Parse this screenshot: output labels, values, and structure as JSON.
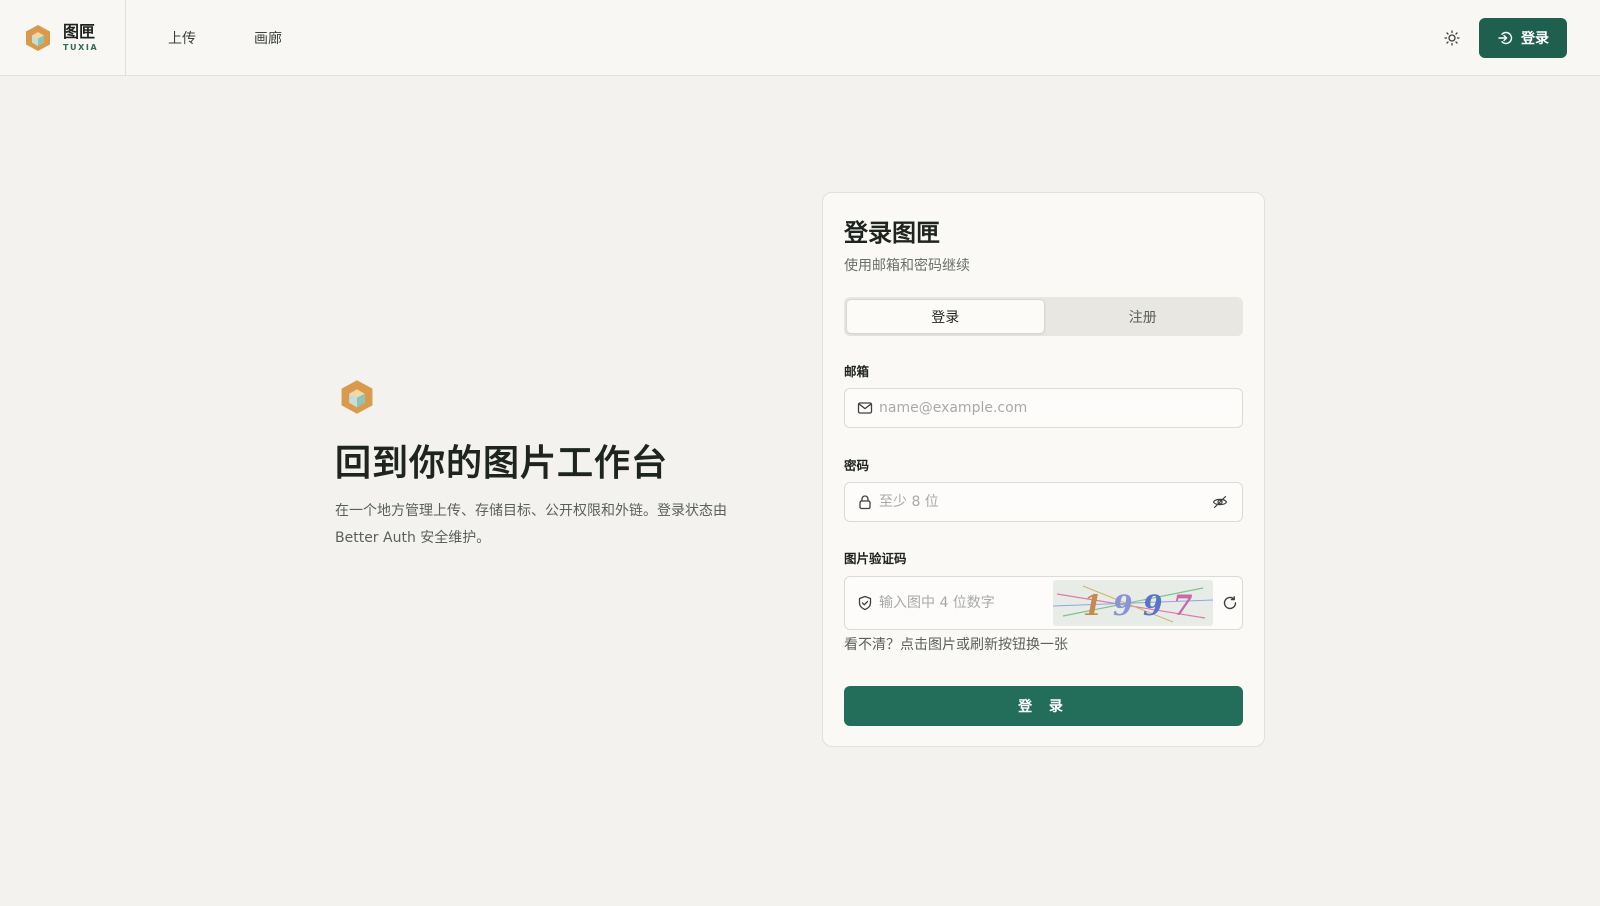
{
  "brand": {
    "name": "图匣",
    "subtitle": "TUXIA",
    "logo_icon": "cube-logo-icon"
  },
  "nav": {
    "items": [
      {
        "label": "上传"
      },
      {
        "label": "画廊"
      }
    ]
  },
  "header": {
    "theme_icon": "sun-icon",
    "login_label": "登录",
    "login_icon": "login-arrow-icon"
  },
  "hero": {
    "title": "回到你的图片工作台",
    "description": "在一个地方管理上传、存储目标、公开权限和外链。登录状态由 Better Auth 安全维护。"
  },
  "card": {
    "title": "登录图匣",
    "subtitle": "使用邮箱和密码继续",
    "tabs": [
      {
        "label": "登录",
        "active": true
      },
      {
        "label": "注册",
        "active": false
      }
    ],
    "email": {
      "label": "邮箱",
      "placeholder": "name@example.com",
      "value": "",
      "icon": "mail-icon"
    },
    "password": {
      "label": "密码",
      "placeholder": "至少 8 位",
      "value": "",
      "icon": "lock-icon",
      "toggle_icon": "eye-off-icon"
    },
    "captcha": {
      "label": "图片验证码",
      "placeholder": "输入图中 4 位数字",
      "value": "",
      "icon": "shield-check-icon",
      "image_digits": "1997",
      "refresh_icon": "refresh-icon",
      "hint": "看不清？点击图片或刷新按钮换一张"
    },
    "submit_label": "登 录"
  },
  "colors": {
    "accent": "#1f5f4e",
    "button": "#236e5b",
    "background": "#f3f2ee",
    "logo_orange": "#d99a4e"
  }
}
